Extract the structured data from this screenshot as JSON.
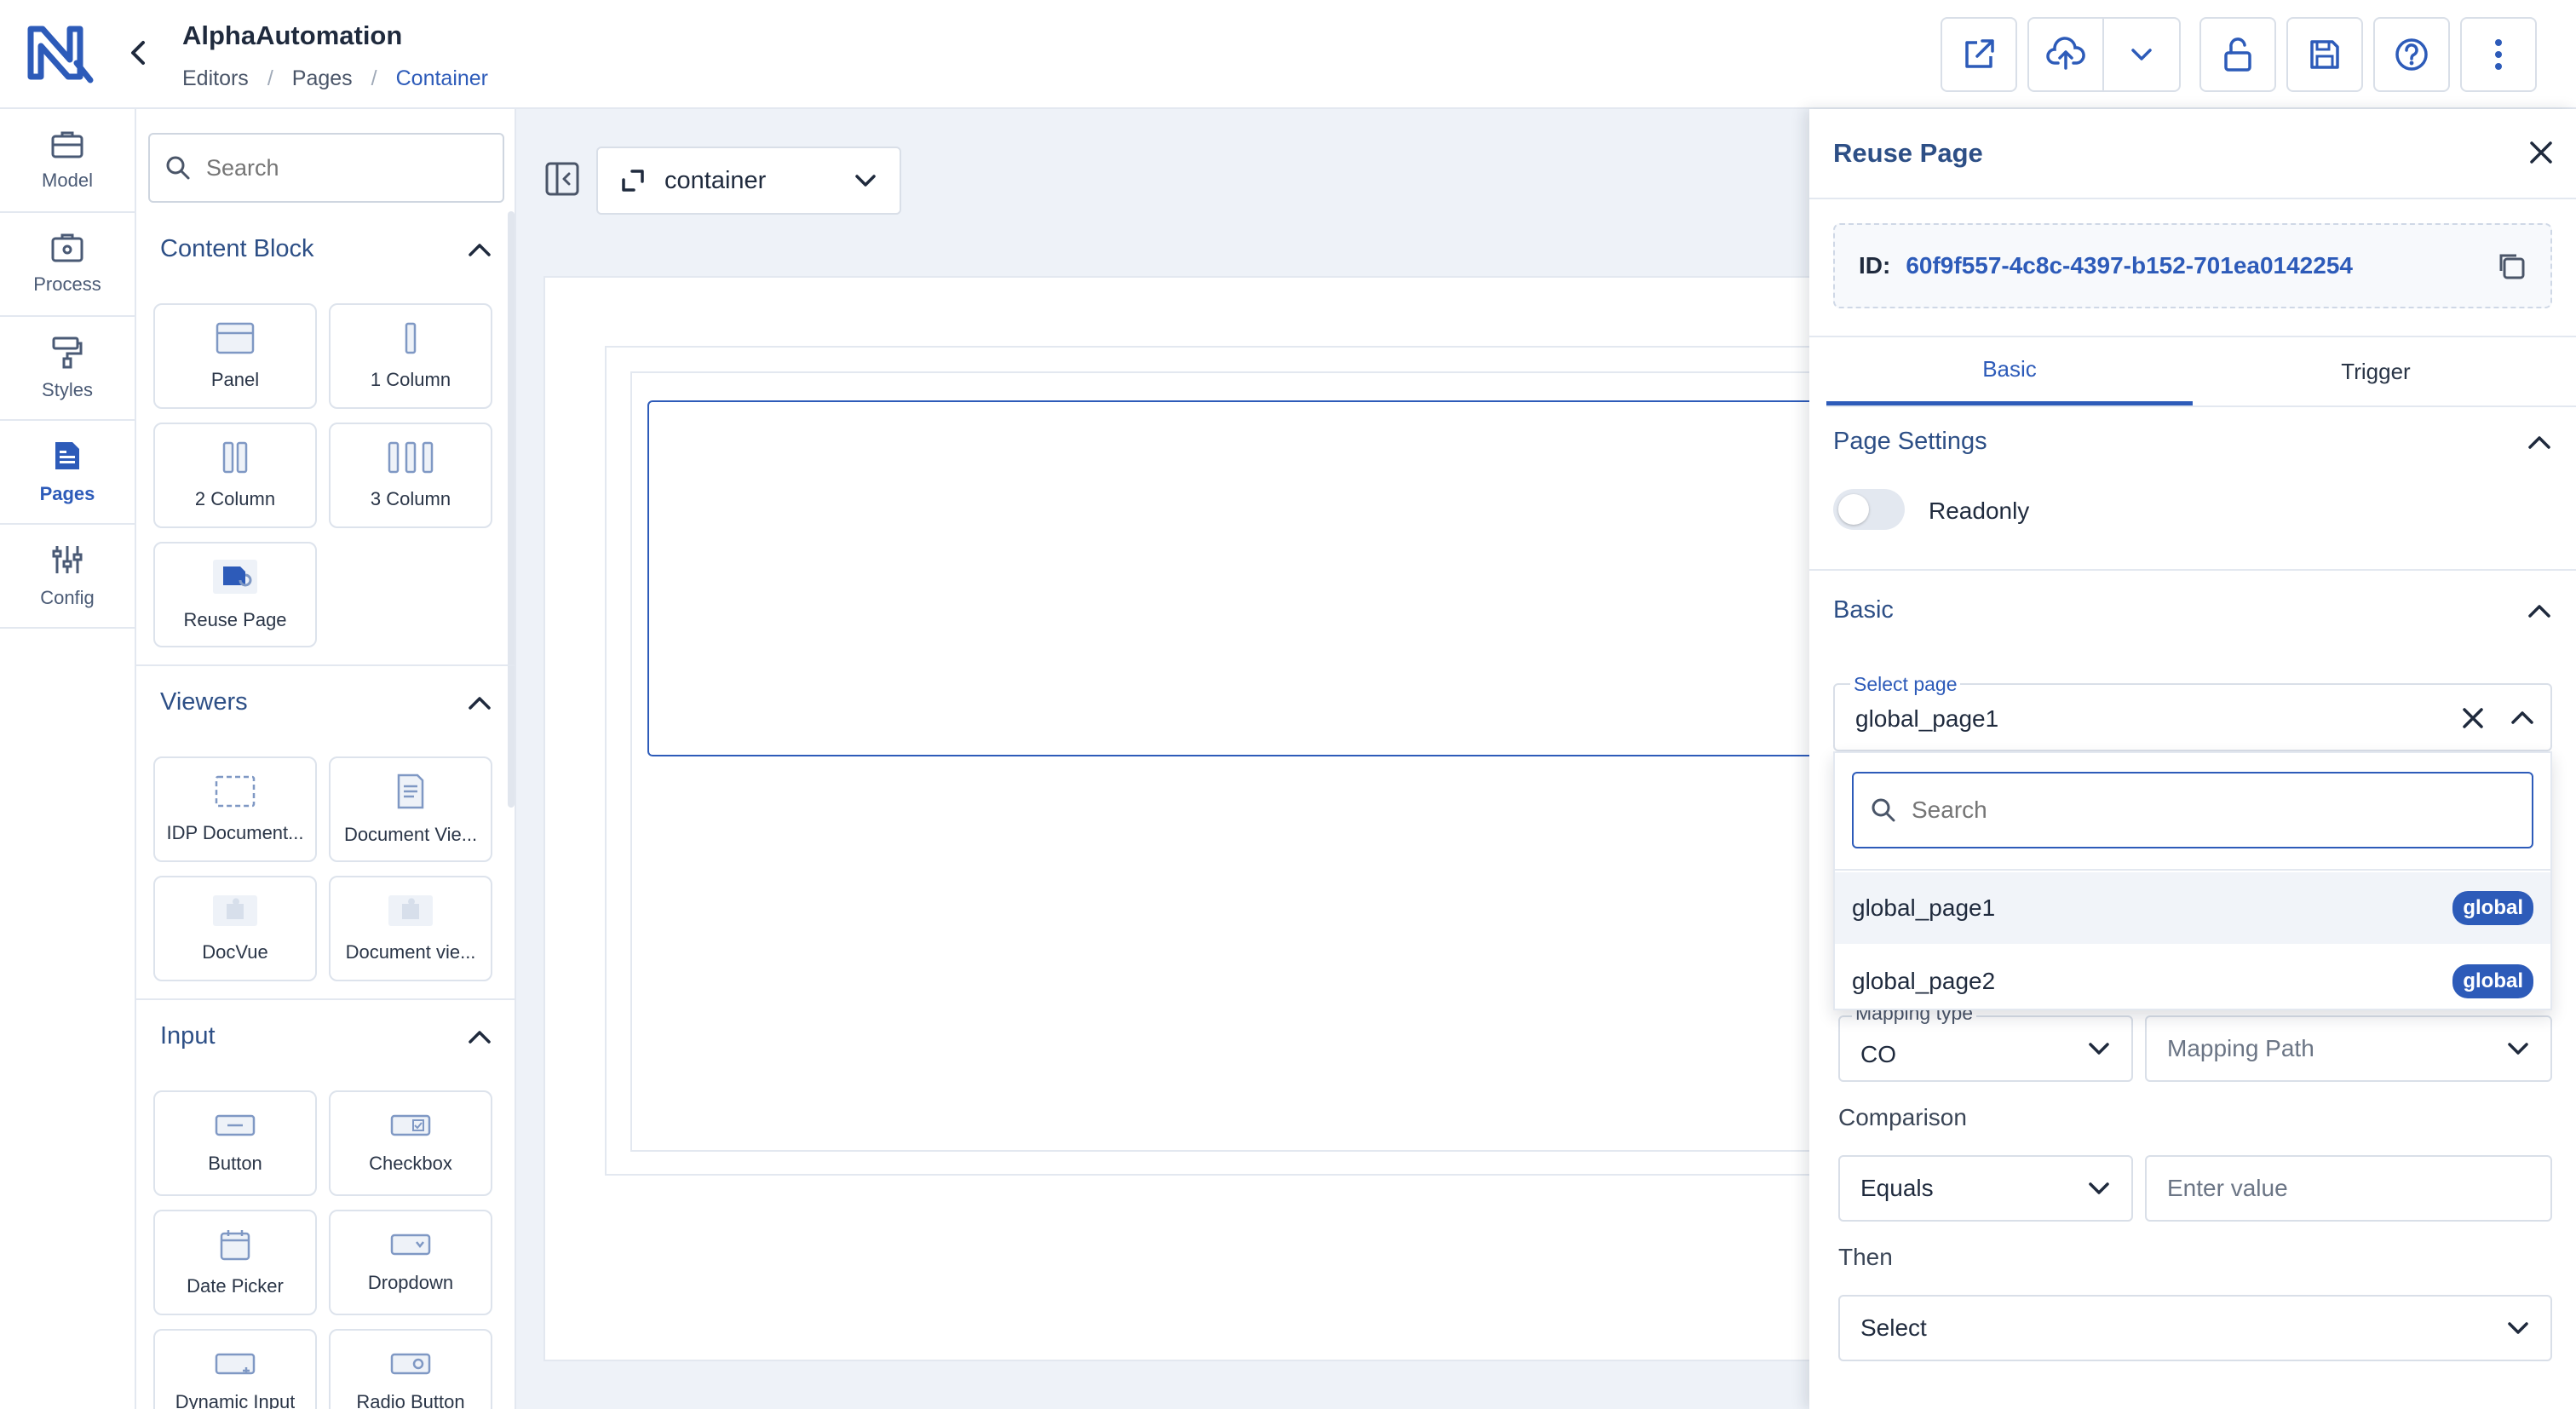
{
  "header": {
    "app_title": "AlphaAutomation",
    "breadcrumb": [
      "Editors",
      "Pages",
      "Container"
    ]
  },
  "rail": {
    "items": [
      {
        "label": "Model",
        "icon": "briefcase-icon"
      },
      {
        "label": "Process",
        "icon": "process-icon"
      },
      {
        "label": "Styles",
        "icon": "paint-roller-icon"
      },
      {
        "label": "Pages",
        "icon": "pages-icon",
        "active": true
      },
      {
        "label": "Config",
        "icon": "sliders-icon"
      }
    ]
  },
  "components": {
    "search_placeholder": "Search",
    "sections": [
      {
        "title": "Content Block",
        "items": [
          "Panel",
          "1 Column",
          "2 Column",
          "3 Column",
          "Reuse Page"
        ]
      },
      {
        "title": "Viewers",
        "items": [
          "IDP Document...",
          "Document Vie...",
          "DocVue",
          "Document vie..."
        ]
      },
      {
        "title": "Input",
        "items": [
          "Button",
          "Checkbox",
          "Date Picker",
          "Dropdown",
          "Dynamic Input",
          "Radio Button"
        ]
      }
    ]
  },
  "canvas": {
    "container_select_value": "container"
  },
  "drawer": {
    "title": "Reuse Page",
    "id_label": "ID:",
    "id_value": "60f9f557-4c8c-4397-b152-701ea0142254",
    "tabs": [
      "Basic",
      "Trigger"
    ],
    "active_tab": "Basic",
    "page_settings_title": "Page Settings",
    "readonly_label": "Readonly",
    "readonly_on": false,
    "basic_title": "Basic",
    "select_page_label": "Select page",
    "select_page_value": "global_page1",
    "dropdown": {
      "search_placeholder": "Search",
      "options": [
        {
          "label": "global_page1",
          "badge": "global"
        },
        {
          "label": "global_page2",
          "badge": "global"
        }
      ]
    },
    "mapping_type_label": "Mapping type",
    "mapping_type_value": "CO",
    "mapping_path_placeholder": "Mapping Path",
    "comparison_label": "Comparison",
    "comparison_value": "Equals",
    "enter_value_placeholder": "Enter value",
    "then_label": "Then",
    "then_value": "Select"
  },
  "colors": {
    "accent": "#2d5bb9",
    "heading": "#2d4f86",
    "border": "#d9dfe8"
  }
}
